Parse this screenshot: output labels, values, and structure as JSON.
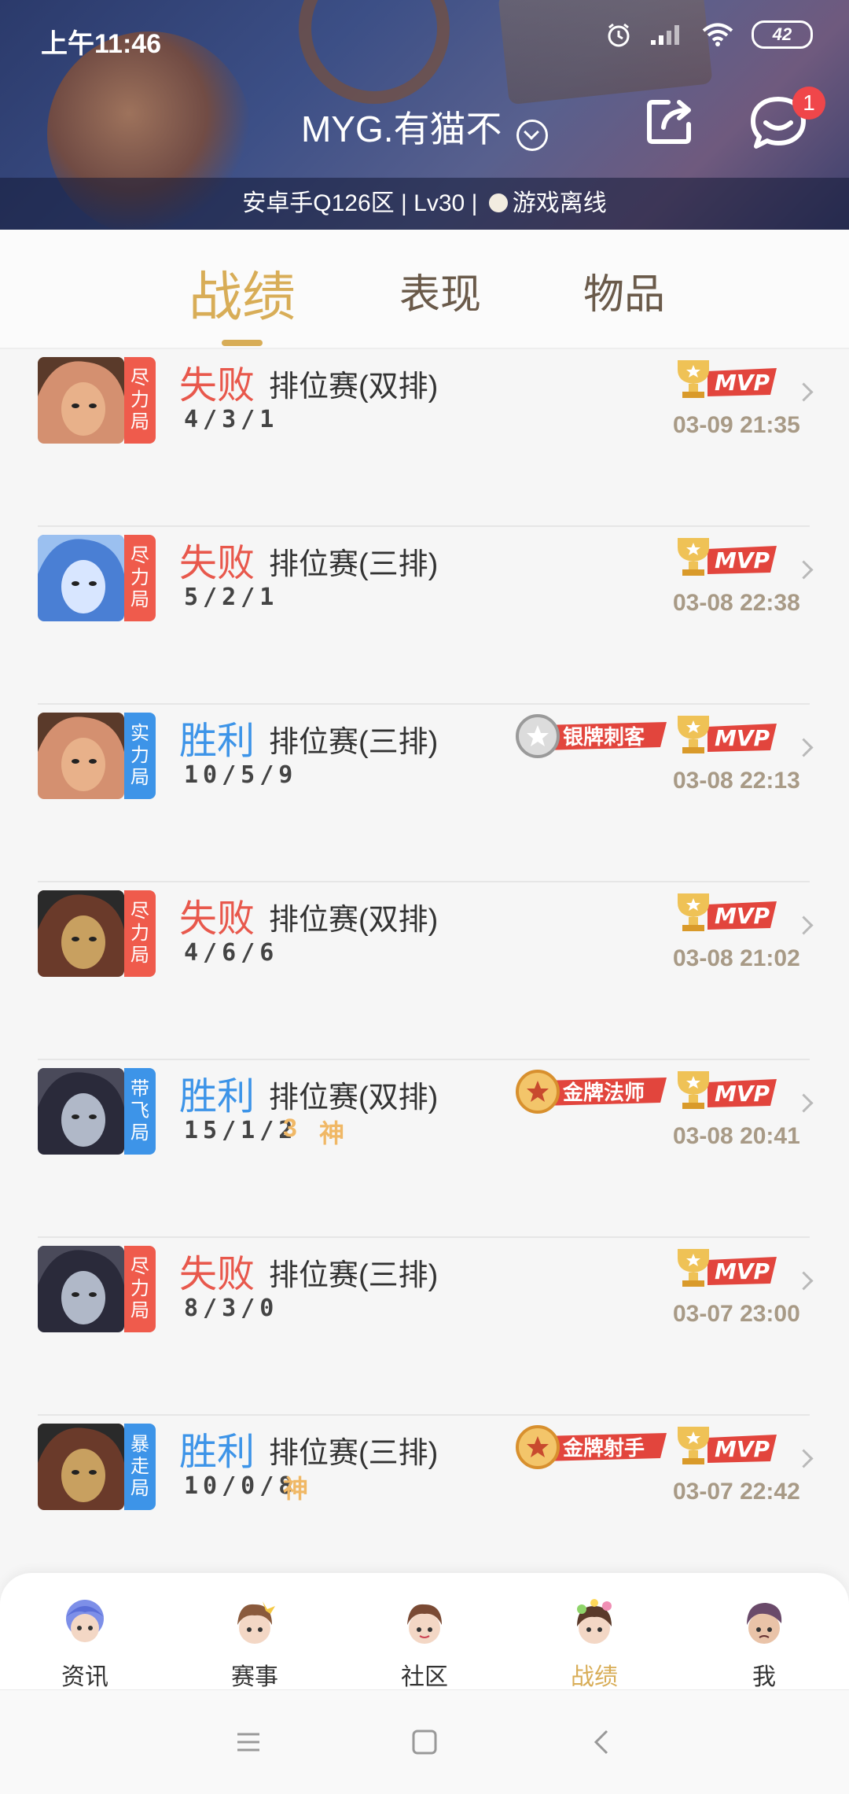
{
  "status_bar": {
    "time": "上午11:46",
    "battery": "42",
    "icons": [
      "alarm-icon",
      "signal-icon",
      "wifi-icon",
      "battery-icon"
    ]
  },
  "header": {
    "player_name": "MYG.有猫不",
    "server": "安卓手Q126区",
    "level": "Lv30",
    "separator": "|",
    "online_status": "游戏离线",
    "message_badge": "1"
  },
  "tabs": [
    {
      "label": "战绩",
      "active": true
    },
    {
      "label": "表现",
      "active": false
    },
    {
      "label": "物品",
      "active": false
    }
  ],
  "matches": [
    {
      "result": "失败",
      "outcome": "lose",
      "queue": "排位赛(双排)",
      "kda": "4/3/1",
      "mode_tag": [
        "尽",
        "力",
        "局"
      ],
      "tag_color": "#ef5b4c",
      "medal": "",
      "god": [],
      "mvp": "MVP",
      "date": "03-09 21:35",
      "hero_icon": "hero-a-icon"
    },
    {
      "result": "失败",
      "outcome": "lose",
      "queue": "排位赛(三排)",
      "kda": "5/2/1",
      "mode_tag": [
        "尽",
        "力",
        "局"
      ],
      "tag_color": "#ef5b4c",
      "medal": "",
      "god": [],
      "mvp": "MVP",
      "date": "03-08 22:38",
      "hero_icon": "hero-b-icon"
    },
    {
      "result": "胜利",
      "outcome": "win",
      "queue": "排位赛(三排)",
      "kda": "10/5/9",
      "mode_tag": [
        "实",
        "力",
        "局"
      ],
      "tag_color": "#3d94e8",
      "medal": "银牌刺客",
      "medal_type": "silver",
      "god": [],
      "mvp": "MVP",
      "date": "03-08 22:13",
      "hero_icon": "hero-a-icon"
    },
    {
      "result": "失败",
      "outcome": "lose",
      "queue": "排位赛(双排)",
      "kda": "4/6/6",
      "mode_tag": [
        "尽",
        "力",
        "局"
      ],
      "tag_color": "#ef5b4c",
      "medal": "",
      "god": [],
      "mvp": "MVP",
      "date": "03-08 21:02",
      "hero_icon": "hero-c-icon"
    },
    {
      "result": "胜利",
      "outcome": "win",
      "queue": "排位赛(双排)",
      "kda": "15/1/2",
      "mode_tag": [
        "带",
        "飞",
        "局"
      ],
      "tag_color": "#3d94e8",
      "medal": "金牌法师",
      "medal_type": "gold",
      "god": [
        "3",
        "神"
      ],
      "mvp": "MVP",
      "date": "03-08 20:41",
      "hero_icon": "hero-d-icon"
    },
    {
      "result": "失败",
      "outcome": "lose",
      "queue": "排位赛(三排)",
      "kda": "8/3/0",
      "mode_tag": [
        "尽",
        "力",
        "局"
      ],
      "tag_color": "#ef5b4c",
      "medal": "",
      "god": [],
      "mvp": "MVP",
      "date": "03-07 23:00",
      "hero_icon": "hero-d-icon"
    },
    {
      "result": "胜利",
      "outcome": "win",
      "queue": "排位赛(三排)",
      "kda": "10/0/8",
      "mode_tag": [
        "暴",
        "走",
        "局"
      ],
      "tag_color": "#3d94e8",
      "medal": "金牌射手",
      "medal_type": "gold",
      "god": [
        "神"
      ],
      "mvp": "MVP",
      "date": "03-07 22:42",
      "hero_icon": "hero-c-icon"
    }
  ],
  "bottom_nav": [
    {
      "label": "资讯",
      "icon": "news-mascot-icon",
      "active": false
    },
    {
      "label": "赛事",
      "icon": "events-mascot-icon",
      "active": false
    },
    {
      "label": "社区",
      "icon": "community-mascot-icon",
      "active": false
    },
    {
      "label": "战绩",
      "icon": "record-mascot-icon",
      "active": true
    },
    {
      "label": "我",
      "icon": "profile-mascot-icon",
      "active": false
    }
  ],
  "system_nav": [
    "menu-icon",
    "home-icon",
    "back-icon"
  ],
  "colors": {
    "accent": "#d8ad57",
    "lose": "#e8584c",
    "win": "#3d94e8",
    "badge": "#f0464a"
  }
}
